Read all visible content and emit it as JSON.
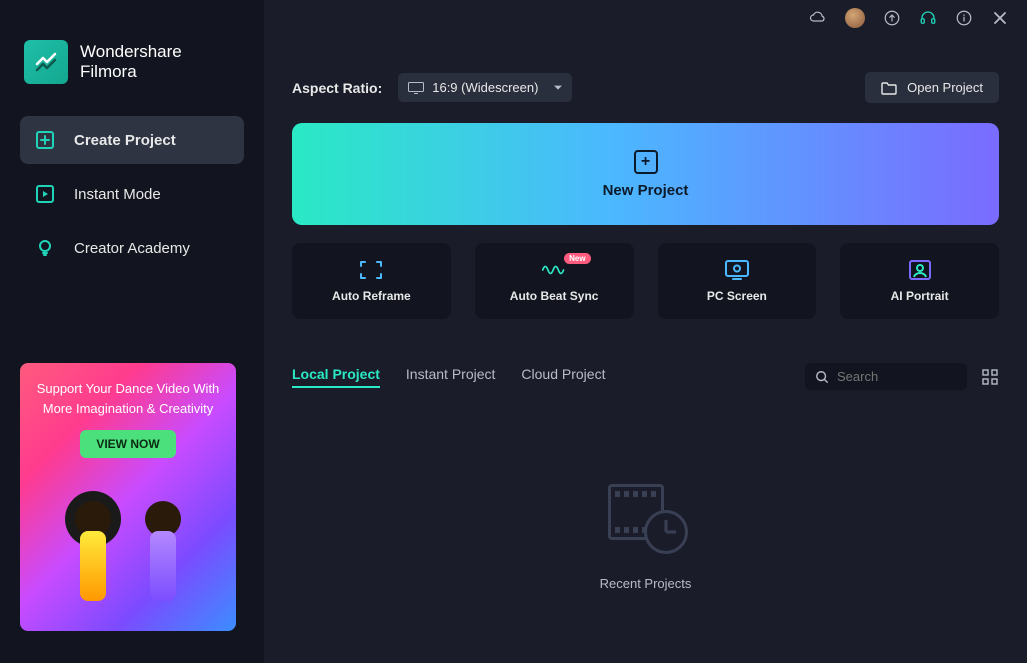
{
  "app": {
    "brand_line1": "Wondershare",
    "brand_line2": "Filmora"
  },
  "sidebar": {
    "items": [
      {
        "label": "Create Project"
      },
      {
        "label": "Instant Mode"
      },
      {
        "label": "Creator Academy"
      }
    ]
  },
  "promo": {
    "line1": "Support Your Dance Video With",
    "line2": "More Imagination & Creativity",
    "button": "VIEW NOW"
  },
  "toolbar": {
    "aspect_label": "Aspect Ratio:",
    "aspect_value": "16:9 (Widescreen)",
    "open_project": "Open Project"
  },
  "new_project": {
    "label": "New Project"
  },
  "cards": [
    {
      "label": "Auto Reframe",
      "badge": ""
    },
    {
      "label": "Auto Beat Sync",
      "badge": "New"
    },
    {
      "label": "PC Screen",
      "badge": ""
    },
    {
      "label": "AI Portrait",
      "badge": ""
    }
  ],
  "tabs": [
    {
      "label": "Local Project",
      "active": true
    },
    {
      "label": "Instant Project",
      "active": false
    },
    {
      "label": "Cloud Project",
      "active": false
    }
  ],
  "search": {
    "placeholder": "Search"
  },
  "recent": {
    "label": "Recent Projects"
  }
}
